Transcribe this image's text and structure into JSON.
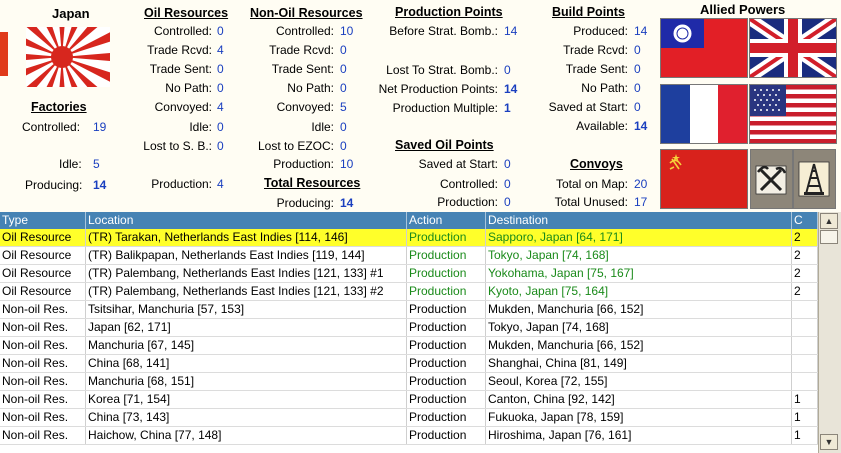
{
  "country": "Japan",
  "factories": {
    "heading": "Factories",
    "controlled_label": "Controlled:",
    "controlled": "19",
    "idle_label": "Idle:",
    "idle": "5",
    "producing_label": "Producing:",
    "producing": "14"
  },
  "oil": {
    "heading": "Oil Resources",
    "rows": [
      {
        "label": "Controlled:",
        "value": "0"
      },
      {
        "label": "Trade Rcvd:",
        "value": "4"
      },
      {
        "label": "Trade Sent:",
        "value": "0"
      },
      {
        "label": "No Path:",
        "value": "0"
      },
      {
        "label": "Convoyed:",
        "value": "4"
      },
      {
        "label": "Idle:",
        "value": "0"
      },
      {
        "label": "Lost to S. B.:",
        "value": "0"
      }
    ],
    "production_label": "Production:",
    "production": "4"
  },
  "nonoil": {
    "heading": "Non-Oil Resources",
    "rows": [
      {
        "label": "Controlled:",
        "value": "10"
      },
      {
        "label": "Trade Rcvd:",
        "value": "0"
      },
      {
        "label": "Trade Sent:",
        "value": "0"
      },
      {
        "label": "No Path:",
        "value": "0"
      },
      {
        "label": "Convoyed:",
        "value": "5"
      },
      {
        "label": "Idle:",
        "value": "0"
      },
      {
        "label": "Lost to EZOC:",
        "value": "0"
      },
      {
        "label": "Production:",
        "value": "10"
      }
    ]
  },
  "total": {
    "heading": "Total Resources",
    "producing_label": "Producing:",
    "producing": "14"
  },
  "production_points": {
    "heading": "Production Points",
    "before_label": "Before Strat. Bomb.:",
    "before": "14",
    "lost_label": "Lost To Strat. Bomb.:",
    "lost": "0",
    "net_label": "Net Production Points:",
    "net": "14",
    "multiple_label": "Production Multiple:",
    "multiple": "1"
  },
  "saved_oil": {
    "heading": "Saved Oil Points",
    "saved_label": "Saved at Start:",
    "saved": "0",
    "controlled_label": "Controlled:",
    "controlled": "0",
    "production_label": "Production:",
    "production": "0"
  },
  "build_points": {
    "heading": "Build Points",
    "produced_label": "Produced:",
    "produced": "14",
    "rcvd_label": "Trade Rcvd:",
    "rcvd": "0",
    "sent_label": "Trade Sent:",
    "sent": "0",
    "nopath_label": "No Path:",
    "nopath": "0",
    "saved_label": "Saved at Start:",
    "saved": "0",
    "available_label": "Available:",
    "available": "14"
  },
  "convoys": {
    "heading": "Convoys",
    "onmap_label": "Total on Map:",
    "onmap": "20",
    "unused_label": "Total Unused:",
    "unused": "17"
  },
  "allied": {
    "heading": "Allied Powers",
    "icons": [
      "china-flag-icon",
      "union-jack-icon",
      "france-flag-icon",
      "usa-flag-icon",
      "ussr-flag-icon",
      "mining-icon",
      "oil-derrick-icon"
    ]
  },
  "colors": {
    "selected_row": "#ffff2a",
    "header_bg": "#4683b4",
    "value_blue": "#1a3fbf",
    "green_text": "#1a8a1a"
  },
  "table": {
    "columns": [
      "Type",
      "Location",
      "Action",
      "Destination",
      "C"
    ],
    "rows": [
      {
        "type": "Oil Resource",
        "location": "(TR) Tarakan, Netherlands East Indies [114, 146]",
        "action": "Production",
        "destination": "Sapporo, Japan [64, 171]",
        "c": "2",
        "green": true,
        "selected": true
      },
      {
        "type": "Oil Resource",
        "location": "(TR) Balikpapan, Netherlands East Indies [119, 144]",
        "action": "Production",
        "destination": "Tokyo, Japan [74, 168]",
        "c": "2",
        "green": true,
        "selected": false
      },
      {
        "type": "Oil Resource",
        "location": "(TR) Palembang, Netherlands East Indies [121, 133] #1",
        "action": "Production",
        "destination": "Yokohama, Japan [75, 167]",
        "c": "2",
        "green": true,
        "selected": false
      },
      {
        "type": "Oil Resource",
        "location": "(TR) Palembang, Netherlands East Indies [121, 133] #2",
        "action": "Production",
        "destination": "Kyoto, Japan [75, 164]",
        "c": "2",
        "green": true,
        "selected": false
      },
      {
        "type": "Non-oil Res.",
        "location": "Tsitsihar, Manchuria [57, 153]",
        "action": "Production",
        "destination": "Mukden, Manchuria [66, 152]",
        "c": "",
        "green": false,
        "selected": false
      },
      {
        "type": "Non-oil Res.",
        "location": "Japan [62, 171]",
        "action": "Production",
        "destination": "Tokyo, Japan [74, 168]",
        "c": "",
        "green": false,
        "selected": false
      },
      {
        "type": "Non-oil Res.",
        "location": "Manchuria [67, 145]",
        "action": "Production",
        "destination": "Mukden, Manchuria [66, 152]",
        "c": "",
        "green": false,
        "selected": false
      },
      {
        "type": "Non-oil Res.",
        "location": "China [68, 141]",
        "action": "Production",
        "destination": "Shanghai, China [81, 149]",
        "c": "",
        "green": false,
        "selected": false
      },
      {
        "type": "Non-oil Res.",
        "location": "Manchuria [68, 151]",
        "action": "Production",
        "destination": "Seoul, Korea [72, 155]",
        "c": "",
        "green": false,
        "selected": false
      },
      {
        "type": "Non-oil Res.",
        "location": "Korea [71, 154]",
        "action": "Production",
        "destination": "Canton, China [92, 142]",
        "c": "1",
        "green": false,
        "selected": false
      },
      {
        "type": "Non-oil Res.",
        "location": "China [73, 143]",
        "action": "Production",
        "destination": "Fukuoka, Japan [78, 159]",
        "c": "1",
        "green": false,
        "selected": false
      },
      {
        "type": "Non-oil Res.",
        "location": "Haichow, China [77, 148]",
        "action": "Production",
        "destination": "Hiroshima, Japan [76, 161]",
        "c": "1",
        "green": false,
        "selected": false
      }
    ]
  }
}
